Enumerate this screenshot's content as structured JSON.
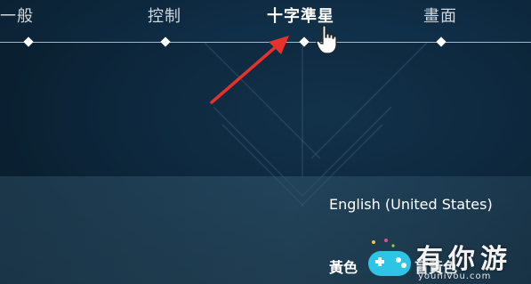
{
  "tabs": [
    {
      "label": "一般",
      "active": false
    },
    {
      "label": "控制",
      "active": false
    },
    {
      "label": "十字準星",
      "active": true
    },
    {
      "label": "畫面",
      "active": false
    }
  ],
  "dropdown": {
    "options": [
      {
        "label": "English (United States)"
      },
      {
        "label": "黃色"
      },
      {
        "label": "盲黃色"
      }
    ]
  },
  "watermark": {
    "brand": "有你游",
    "url": "younivou.com"
  },
  "colors": {
    "annotation_arrow": "#e8312a",
    "tab_active": "#ffffff",
    "tab_inactive": "#cfd6dc",
    "background": "#10304a"
  },
  "icons": {
    "cursor": "hand-pointer-icon",
    "watermark_logo": "gamepad-icon"
  }
}
